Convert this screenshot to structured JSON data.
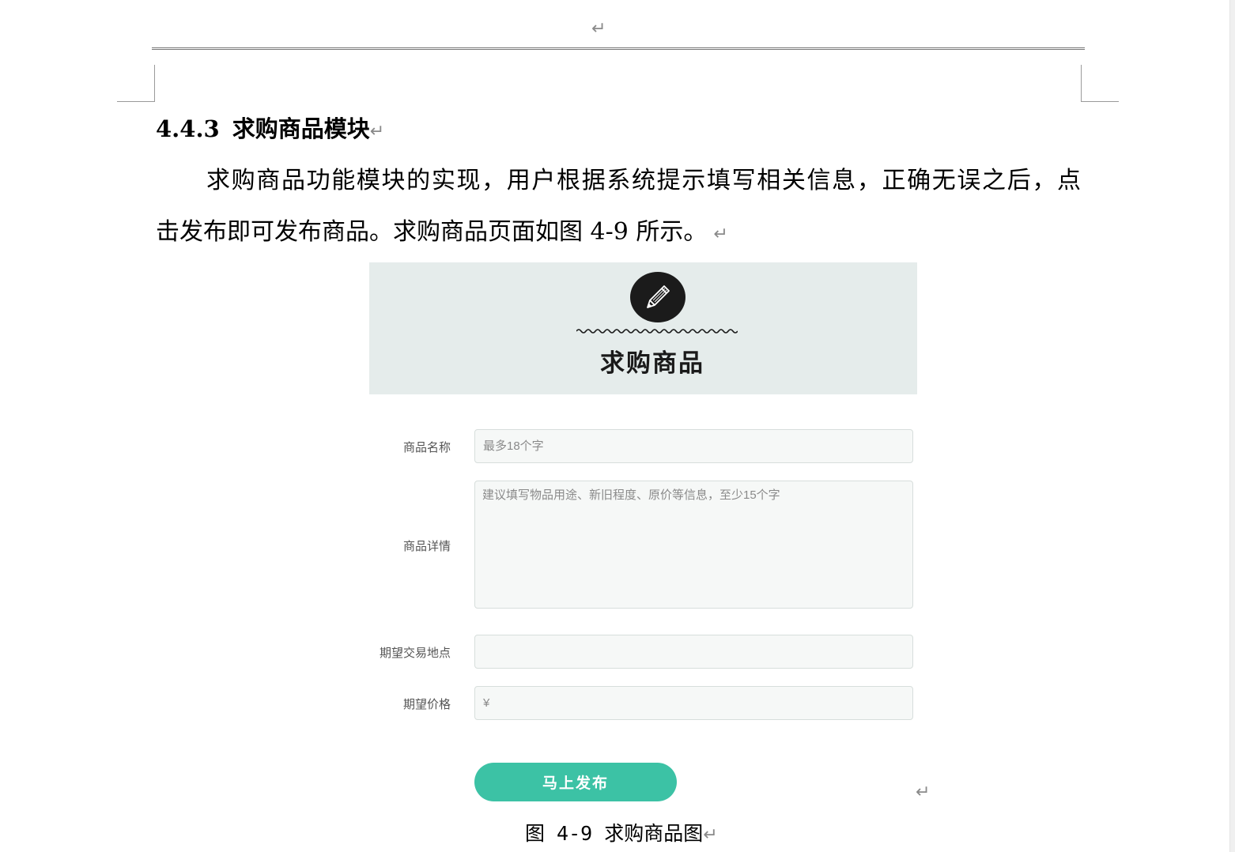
{
  "document": {
    "section_number": "4.4.3",
    "section_title": "求购商品模块",
    "paragraph_line1": "求购商品功能模块的实现，用户根据系统提示填写相关信息，正确无误之后，点",
    "paragraph_line2": "击发布即可发布商品。求购商品页面如图 4-9 所示。",
    "paragraph_mark": "↵",
    "caption": "图 4-9 求购商品图"
  },
  "figure": {
    "banner_title": "求购商品",
    "banner_icon": "pencil-icon",
    "banner_color": "#e5eceb",
    "form": {
      "name_label": "商品名称",
      "name_placeholder": "最多18个字",
      "name_value": "",
      "detail_label": "商品详情",
      "detail_placeholder": "建议填写物品用途、新旧程度、原价等信息，至少15个字",
      "detail_value": "",
      "location_label": "期望交易地点",
      "location_placeholder": "",
      "location_value": "",
      "price_label": "期望价格",
      "price_placeholder": "¥",
      "price_value": ""
    },
    "submit_label": "马上发布",
    "accent_color": "#3cc2a5"
  }
}
